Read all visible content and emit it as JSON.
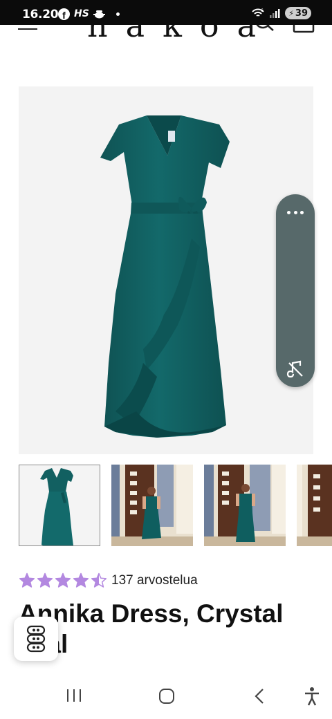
{
  "status_bar": {
    "time": "16.20",
    "app_icons": [
      "facebook-icon",
      "hs-icon",
      "cooking-pot-icon",
      "notification-dot"
    ],
    "hs_text": "HS",
    "network_label": "6",
    "battery": "39"
  },
  "header": {
    "logo": "nakoa",
    "icons": [
      "menu-icon",
      "search-icon",
      "cart-icon"
    ]
  },
  "product": {
    "rating_value": 4.5,
    "rating_max": 5,
    "review_count": "137 arvostelua",
    "title": "Annika Dress, Crystal Teal",
    "dress_color": "#125f60",
    "star_color": "#b388e0"
  },
  "gallery": {
    "thumbnail_count": 4,
    "selected_index": 0
  },
  "side_widget": {
    "icons": [
      "more-icon",
      "mute-icon"
    ],
    "color": "#57696a"
  },
  "chat": {
    "icon": "chat-icon"
  },
  "nav_bar": {
    "icons": [
      "recent-apps-icon",
      "home-icon",
      "back-icon",
      "accessibility-icon"
    ]
  }
}
